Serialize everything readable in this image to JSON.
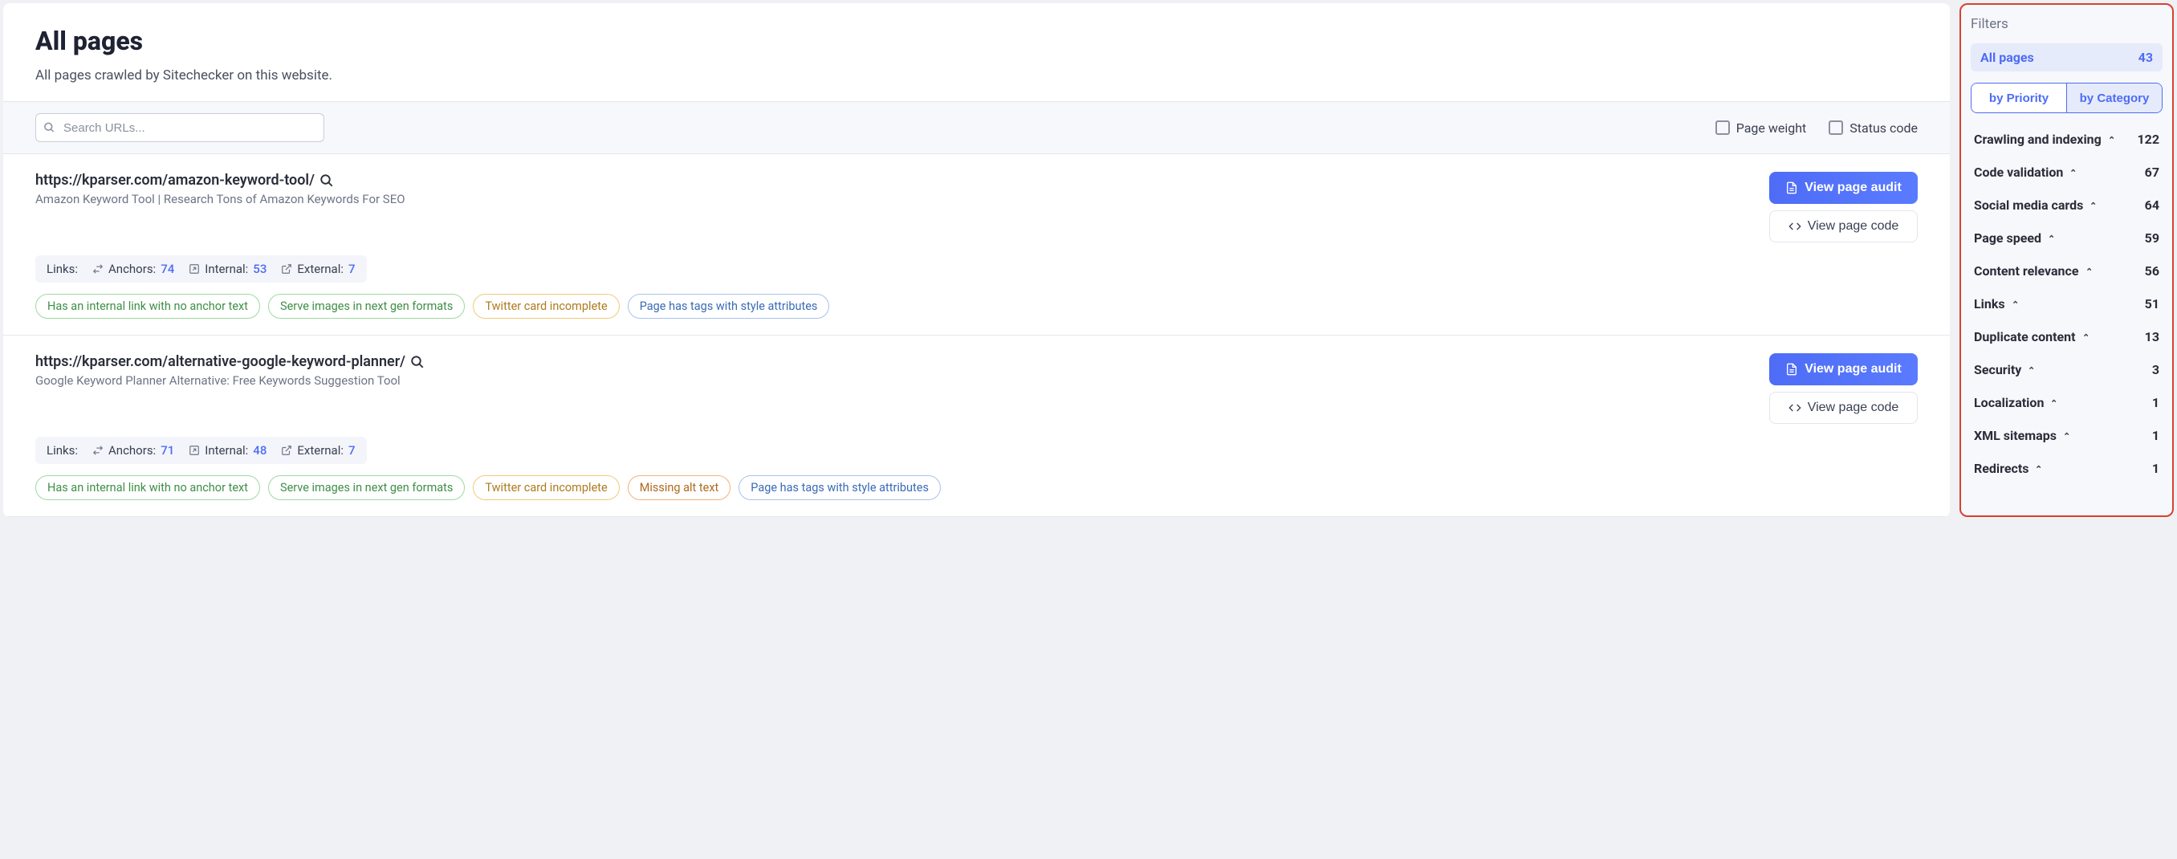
{
  "header": {
    "title": "All pages",
    "subtitle": "All pages crawled by Sitechecker on this website."
  },
  "toolbar": {
    "search_placeholder": "Search URLs...",
    "checks": [
      {
        "label": "Page weight"
      },
      {
        "label": "Status code"
      }
    ]
  },
  "actions": {
    "view_audit": "View page audit",
    "view_code": "View page code"
  },
  "links_labels": {
    "prefix": "Links:",
    "anchors": "Anchors:",
    "internal": "Internal:",
    "external": "External:"
  },
  "pages": [
    {
      "url": "https://kparser.com/amazon-keyword-tool/",
      "subtitle": "Amazon Keyword Tool | Research Tons of Amazon Keywords For SEO",
      "anchors": "74",
      "internal": "53",
      "external": "7",
      "tags": [
        {
          "text": "Has an internal link with no anchor text",
          "cls": "tag-green"
        },
        {
          "text": "Serve images in next gen formats",
          "cls": "tag-green"
        },
        {
          "text": "Twitter card incomplete",
          "cls": "tag-yellow"
        },
        {
          "text": "Page has tags with style attributes",
          "cls": "tag-blue"
        }
      ]
    },
    {
      "url": "https://kparser.com/alternative-google-keyword-planner/",
      "subtitle": "Google Keyword Planner Alternative: Free Keywords Suggestion Tool",
      "anchors": "71",
      "internal": "48",
      "external": "7",
      "tags": [
        {
          "text": "Has an internal link with no anchor text",
          "cls": "tag-green"
        },
        {
          "text": "Serve images in next gen formats",
          "cls": "tag-green"
        },
        {
          "text": "Twitter card incomplete",
          "cls": "tag-yellow"
        },
        {
          "text": "Missing alt text",
          "cls": "tag-orange"
        },
        {
          "text": "Page has tags with style attributes",
          "cls": "tag-blue"
        }
      ]
    }
  ],
  "sidebar": {
    "title": "Filters",
    "active": {
      "label": "All pages",
      "count": "43"
    },
    "by_priority": "by Priority",
    "by_category": "by Category",
    "categories": [
      {
        "label": "Crawling and indexing",
        "count": "122"
      },
      {
        "label": "Code validation",
        "count": "67"
      },
      {
        "label": "Social media cards",
        "count": "64"
      },
      {
        "label": "Page speed",
        "count": "59"
      },
      {
        "label": "Content relevance",
        "count": "56"
      },
      {
        "label": "Links",
        "count": "51"
      },
      {
        "label": "Duplicate content",
        "count": "13"
      },
      {
        "label": "Security",
        "count": "3"
      },
      {
        "label": "Localization",
        "count": "1"
      },
      {
        "label": "XML sitemaps",
        "count": "1"
      },
      {
        "label": "Redirects",
        "count": "1"
      }
    ]
  }
}
